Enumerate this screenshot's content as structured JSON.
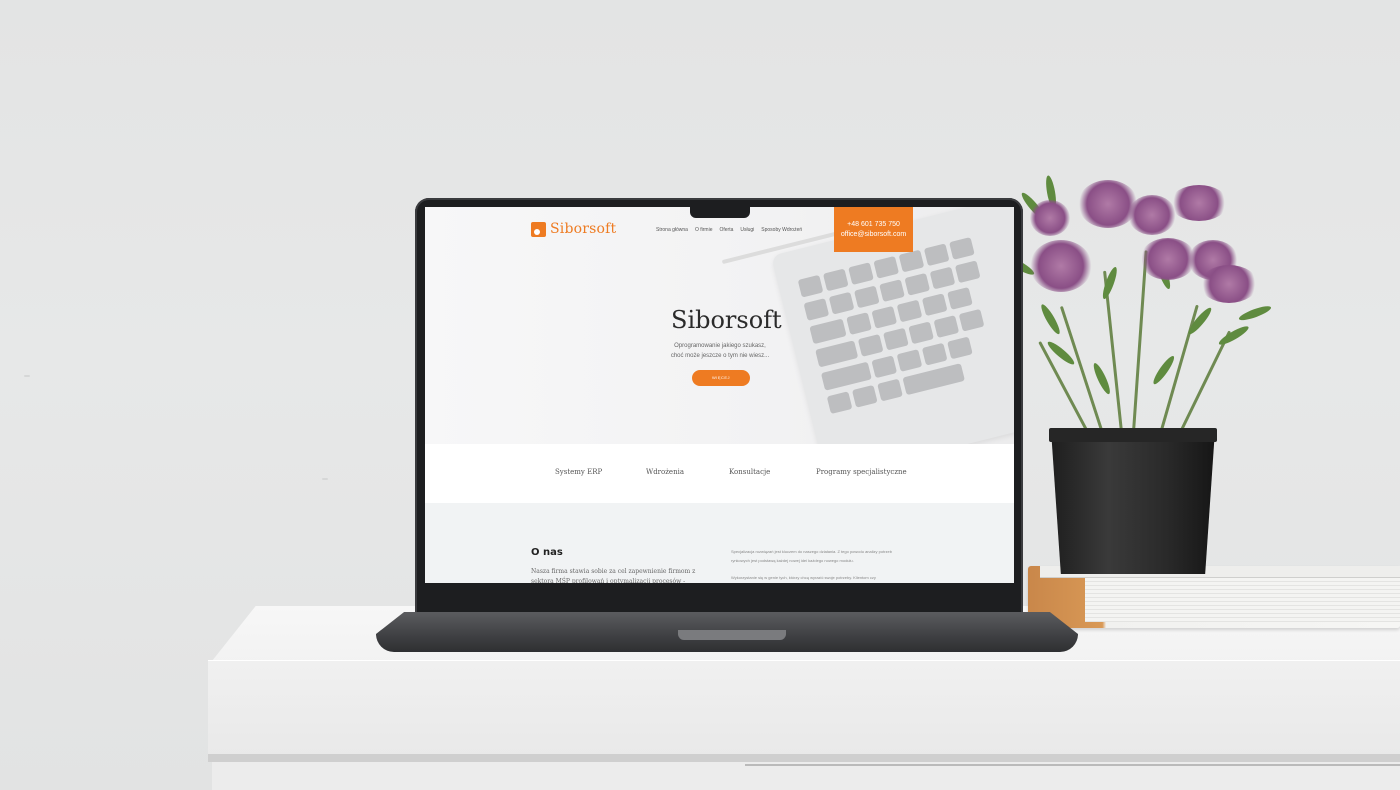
{
  "site": {
    "logo_text": "Siborsoft",
    "menu": [
      "Strona główna",
      "O firmie",
      "Oferta",
      "Usługi",
      "Sposoby Wdrożeń"
    ],
    "contact_phone": "+48 601 735 750",
    "contact_email": "office@siborsoft.com"
  },
  "hero": {
    "title": "Siborsoft",
    "subtitle_line1": "Oprogramowanie jakiego szukasz,",
    "subtitle_line2": "choć może jeszcze o tym nie wiesz...",
    "button_label": "WIĘCEJ"
  },
  "services": [
    "Systemy ERP",
    "Wdrożenia",
    "Konsultacje",
    "Programy specjalistyczne"
  ],
  "about": {
    "title": "O nas",
    "text": "Nasza firma stawia sobie za cel zapewnienie firmom z sektora MŚP profilowań i optymalizacji procesów - podejmując ich",
    "right_p1": "Specjalizacja rozwiązań jest kluczem do naszego działania. Z tego powodu analizy potrzeb rynkowych jest podstawą każdej nowej idei każdego nowego modułu.",
    "right_p2": "Wykorzystanie się w genie tych, którzy chcą wyrazić swoje potrzeby. Klientom czy"
  },
  "colors": {
    "accent": "#ee7b22",
    "laptop_bezel": "#1d1e20",
    "pot": "#262626"
  }
}
